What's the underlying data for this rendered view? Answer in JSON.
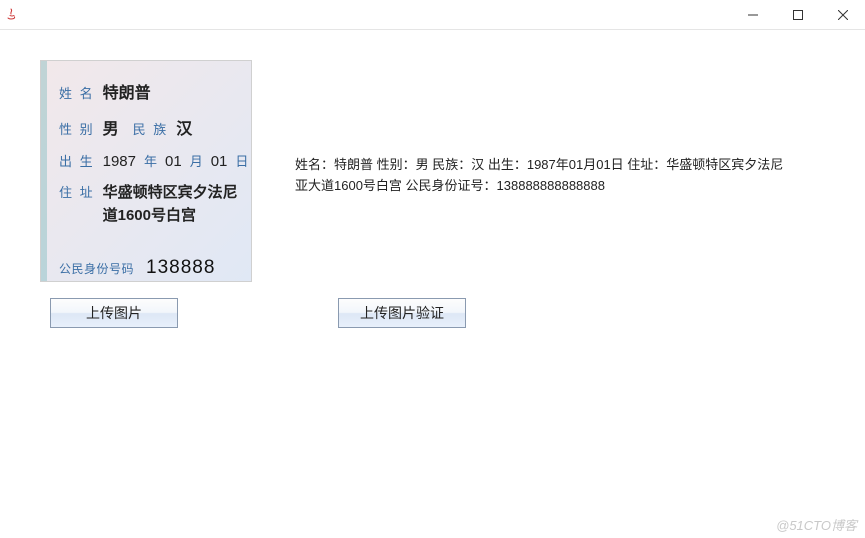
{
  "window": {
    "title": ""
  },
  "id_card": {
    "name_label": "姓 名",
    "name_value": "特朗普",
    "sex_label": "性 别",
    "sex_value": "男",
    "ethnic_label": "民 族",
    "ethnic_value": "汉",
    "birth_label": "出 生",
    "birth_year": "1987",
    "birth_year_suffix": "年",
    "birth_month": "01",
    "birth_month_suffix": "月",
    "birth_day": "01",
    "birth_day_suffix": "日",
    "addr_label": "住 址",
    "addr_value": "华盛顿特区宾夕法尼\n道1600号白宫",
    "idnum_label": "公民身份号码",
    "idnum_value": "138888"
  },
  "result": {
    "text": "姓名：特朗普  性别：男  民族：汉  出生：1987年01月01日  住址：华盛顿特区宾夕法尼亚大道1600号白宫  公民身份证号：138888888888888"
  },
  "buttons": {
    "upload": "上传图片",
    "verify": "上传图片验证"
  },
  "watermark": "@51CTO博客"
}
